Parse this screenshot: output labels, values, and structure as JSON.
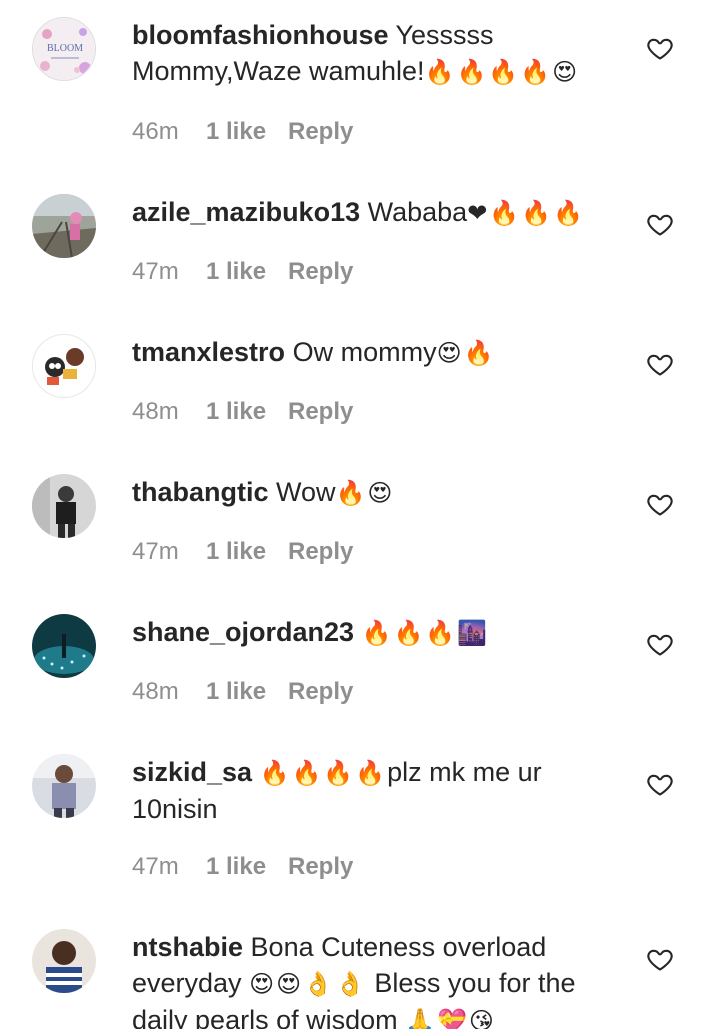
{
  "comments": [
    {
      "username": "bloomfashionhouse",
      "text": "Yesssss Mommy,Waze wamuhle!",
      "emojis": "🔥🔥🔥🔥😍",
      "time": "46m",
      "likes": "1 like",
      "reply": "Reply",
      "avatar_text": "BLOOM"
    },
    {
      "username": "azile_mazibuko13",
      "text": "Wababa",
      "emojis": "❤🔥🔥🔥",
      "time": "47m",
      "likes": "1 like",
      "reply": "Reply"
    },
    {
      "username": "tmanxlestro",
      "text": "Ow mommy",
      "emojis": "😍🔥",
      "time": "48m",
      "likes": "1 like",
      "reply": "Reply"
    },
    {
      "username": "thabangtic",
      "text": "Wow",
      "emojis": "🔥😍",
      "time": "47m",
      "likes": "1 like",
      "reply": "Reply"
    },
    {
      "username": "shane_ojordan23",
      "text": "",
      "emojis": "🔥🔥🔥🌆",
      "time": "48m",
      "likes": "1 like",
      "reply": "Reply"
    },
    {
      "username": "sizkid_sa",
      "text": "plz mk me ur 10nisin",
      "emojis": "🔥🔥🔥🔥",
      "time": "47m",
      "likes": "1 like",
      "reply": "Reply"
    },
    {
      "username": "ntshabie",
      "text": "Bona Cuteness overload everyday",
      "emojis": "😍😍👌👌",
      "text_after": "Bless you for the daily pearls of wisdom",
      "emojis_after": "🙏💝😘"
    }
  ],
  "colors": {
    "text": "#262626",
    "meta": "#8e8e8e",
    "background": "#ffffff"
  },
  "icons": {
    "like": "heart-outline-icon"
  }
}
